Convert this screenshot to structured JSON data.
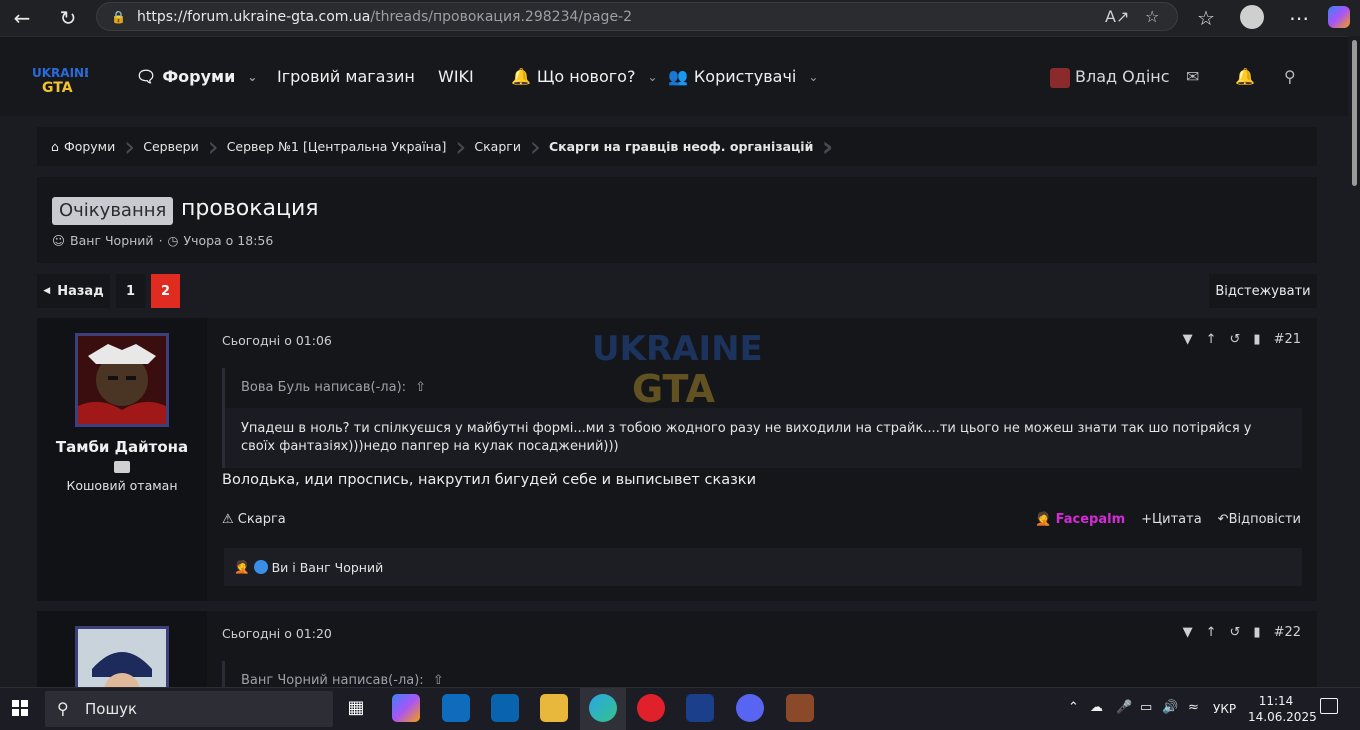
{
  "browser": {
    "url_host": "https://forum.ukraine-gta.com.ua",
    "url_path": "/threads/провокация.298234/page-2"
  },
  "nav": {
    "forums": "Форуми",
    "shop": "Ігровий магазин",
    "wiki": "WIKI",
    "whats_new": "Що нового?",
    "users": "Користувачі",
    "username": "Влад Одінс"
  },
  "breadcrumb": [
    "Форуми",
    "Сервери",
    "Сервер №1 [Центральна Україна]",
    "Скарги",
    "Скарги на гравців неоф. організацій"
  ],
  "thread": {
    "prefix": "Очікування",
    "title": "провокация",
    "author": "Ванг Чорний",
    "date": "Учора о 18:56"
  },
  "pagination": {
    "back": "Назад",
    "pages": [
      "1",
      "2"
    ],
    "current": "2",
    "follow": "Відстежувати"
  },
  "posts": [
    {
      "user": "Тамби Дайтона",
      "role": "Кошовий отаман",
      "date": "Сьогодні о 01:06",
      "number": "#21",
      "quote_author": "Вова Буль написав(-ла):",
      "quote_text": "Упадеш в ноль? ти спілкуєшся у майбутні формі...ми з тобою жодного разу не виходили на страйк....ти цього не можеш знати так шо потіряйся у своїх фантазіях)))недо папгер на кулак посаджений)))",
      "message": "Володька, иди проспись, накрутил бигудей себе и выписывет сказки",
      "report": "Скарга",
      "reaction_label": "Facepalm",
      "quote_btn": "Цитата",
      "reply_btn": "Відповісти",
      "reactions_by": "Ви і Ванг Чорний"
    },
    {
      "date": "Сьогодні о 01:20",
      "number": "#22",
      "quote_author": "Ванг Чорний написав(-ла):"
    }
  ],
  "taskbar": {
    "search": "Пошук",
    "lang": "УКР",
    "time": "11:14",
    "date": "14.06.2025"
  },
  "colors": {
    "accent_red": "#e02b20",
    "facepalm": "#d42bd6",
    "avatar_border": "#3d3f7a"
  }
}
